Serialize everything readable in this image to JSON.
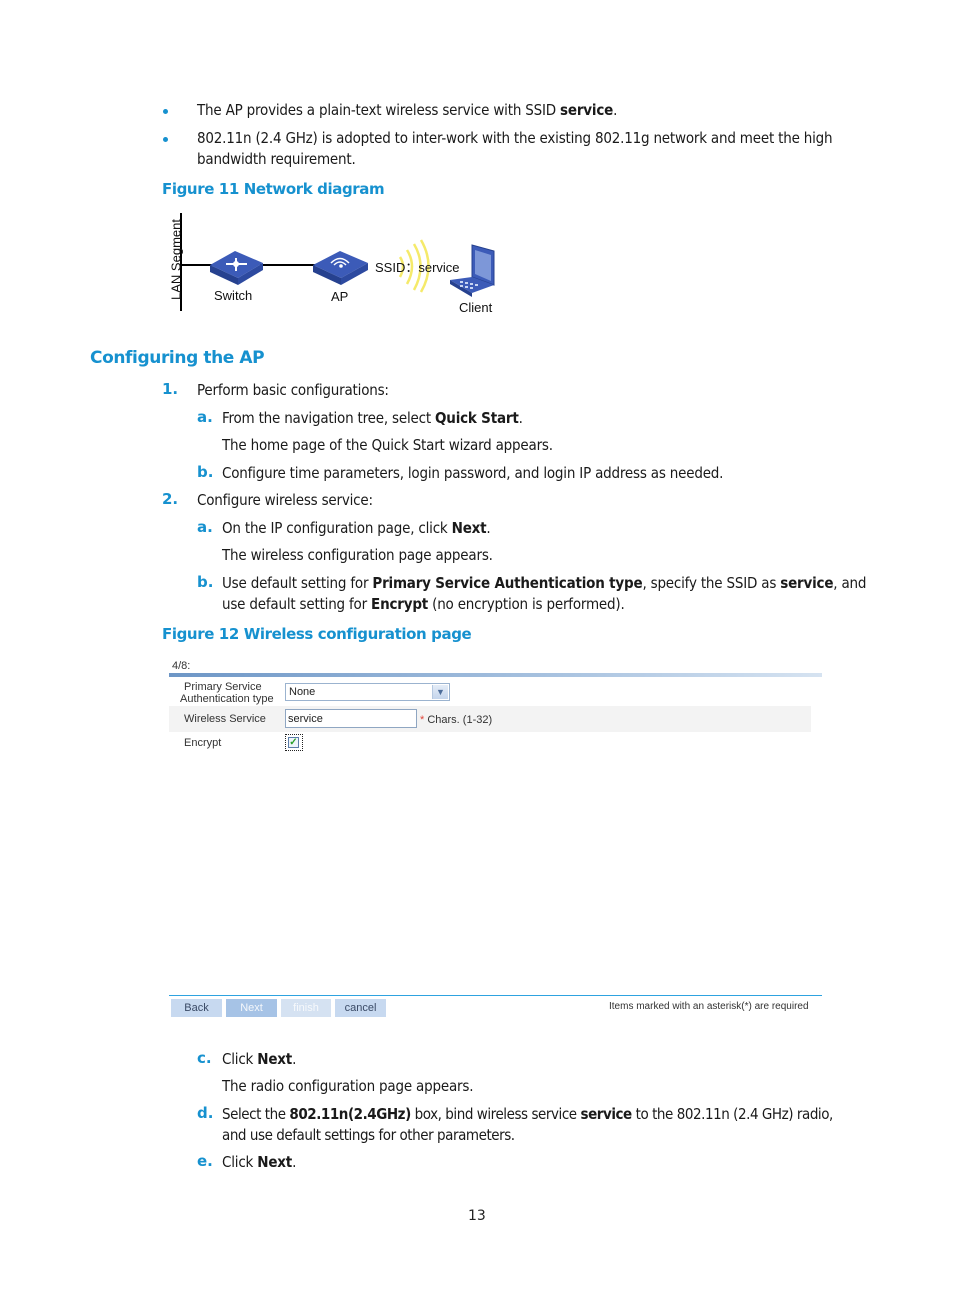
{
  "bullets": [
    {
      "text_before": "The AP provides a plain-text wireless service with SSID ",
      "bold": "service",
      "text_after": "."
    },
    {
      "line1": "802.11n (2.4 GHz) is adopted to inter-work with the existing 802.11g network and meet the high",
      "line2": "bandwidth requirement."
    }
  ],
  "figure11": {
    "caption": "Figure 11 Network diagram",
    "lan_segment": "LAN Segment",
    "switch_label": "Switch",
    "switch_badge": "SWITCH",
    "ap_label": "AP",
    "ssid_label": "SSID：service",
    "client_label": "Client"
  },
  "section": {
    "heading": "Configuring the AP"
  },
  "steps": {
    "s1": {
      "num": "1.",
      "text": "Perform basic configurations:"
    },
    "s1a": {
      "marker": "a.",
      "before": "From the navigation tree, select ",
      "bold": "Quick Start",
      "after": "."
    },
    "s1a_note": "The home page of the Quick Start wizard appears.",
    "s1b": {
      "marker": "b.",
      "text": "Configure time parameters, login password, and login IP address as needed."
    },
    "s2": {
      "num": "2.",
      "text": "Configure wireless service:"
    },
    "s2a": {
      "marker": "a.",
      "before": "On the IP configuration page, click ",
      "bold": "Next",
      "after": "."
    },
    "s2a_note": "The wireless configuration page appears.",
    "s2b": {
      "marker": "b.",
      "t1": "Use default setting for ",
      "b1": "Primary Service Authentication type",
      "t2": ", specify the SSID as ",
      "b2": "service",
      "t3": ", and",
      "t4": "use default setting for ",
      "b3": "Encrypt",
      "t5": " (no encryption is performed)."
    },
    "s2c": {
      "marker": "c.",
      "before": "Click ",
      "bold": "Next",
      "after": "."
    },
    "s2c_note": "The radio configuration page appears.",
    "s2d": {
      "marker": "d.",
      "t1": "Select the ",
      "b1": "802.11n(2.4GHz)",
      "t2": " box, bind wireless service ",
      "b2": "service",
      "t3": " to the 802.11n (2.4 GHz) radio,",
      "t4": "and use default settings for other parameters."
    },
    "s2e": {
      "marker": "e.",
      "before": "Click ",
      "bold": "Next",
      "after": "."
    }
  },
  "figure12": {
    "caption": "Figure 12 Wireless configuration page",
    "step_indicator": "4/8:",
    "auth_label_line1": "Primary Service",
    "auth_label_line2": "Authentication type",
    "auth_value": "None",
    "wireless_service_label": "Wireless Service",
    "wireless_service_value": "service",
    "asterisk": "*",
    "wireless_service_hint": " Chars. (1-32)",
    "encrypt_label": "Encrypt",
    "encrypt_checked": true,
    "buttons": {
      "back": "Back",
      "next": "Next",
      "finish": "finish",
      "cancel": "cancel"
    },
    "required_note": "Items marked with an asterisk(*) are required"
  },
  "page_number": "13"
}
